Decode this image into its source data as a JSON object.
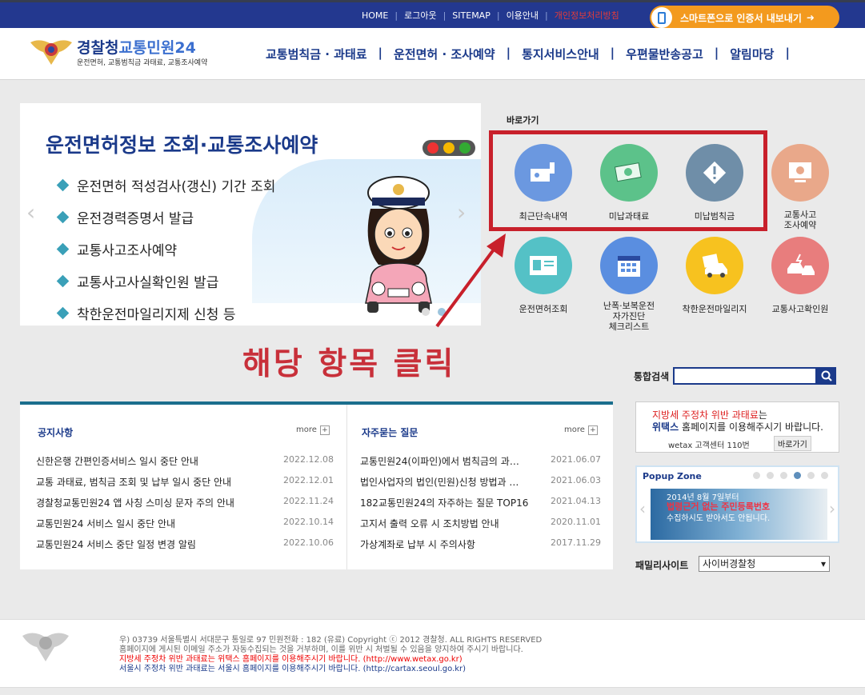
{
  "topbar": {
    "links": [
      "HOME",
      "로그아웃",
      "SITEMAP",
      "이용안내"
    ],
    "privacy": "개인정보처리방침",
    "smart_button": "스마트폰으로 인증서 내보내기"
  },
  "logo": {
    "brand1": "경찰청",
    "brand2": "교통민원24",
    "subtitle": "운전면허, 교통범칙금 과태료, 교통조사예약"
  },
  "gnb": [
    "교통범칙금 · 과태료",
    "운전면허 · 조사예약",
    "통지서비스안내",
    "우편물반송공고",
    "알림마당"
  ],
  "banner": {
    "title": "운전면허정보 조회·교통조사예약",
    "items": [
      "운전면허 적성검사(갱신) 기간 조회",
      "운전경력증명서 발급",
      "교통사고조사예약",
      "교통사고사실확인원 발급",
      "착한운전마일리지제 신청 등"
    ]
  },
  "quick": {
    "title": "바로가기",
    "items": [
      {
        "label": "최근단속내역",
        "color": "#6b98e0",
        "icon": "camera-icon"
      },
      {
        "label": "미납과태료",
        "color": "#5cc28a",
        "icon": "money-icon"
      },
      {
        "label": "미납범칙금",
        "color": "#6f8ea8",
        "icon": "warning-icon"
      },
      {
        "label": "교통사고\n조사예약",
        "color": "#e9a88a",
        "icon": "monitor-icon"
      },
      {
        "label": "운전면허조회",
        "color": "#54c1c6",
        "icon": "id-card-icon"
      },
      {
        "label": "난폭·보복운전\n자가진단\n체크리스트",
        "color": "#5a8ee0",
        "icon": "calendar-icon"
      },
      {
        "label": "착한운전마일리지",
        "color": "#f7c21f",
        "icon": "car-icon"
      },
      {
        "label": "교통사고확인원",
        "color": "#e87d7d",
        "icon": "accident-icon"
      }
    ]
  },
  "annotation": "해당 항목 클릭",
  "search": {
    "label": "통합검색",
    "value": ""
  },
  "notice": {
    "title": "공지사항",
    "more": "more",
    "rows": [
      {
        "text": "신한은행 간편인증서비스 일시 중단 안내",
        "date": "2022.12.08"
      },
      {
        "text": "교통 과태료, 범칙금 조회 및 납부 일시 중단 안내",
        "date": "2022.12.01"
      },
      {
        "text": "경찰청교통민원24 앱 사칭 스미싱 문자 주의 안내",
        "date": "2022.11.24"
      },
      {
        "text": "교통민원24 서비스 일시 중단 안내",
        "date": "2022.10.14"
      },
      {
        "text": "교통민원24 서비스 중단 일정 변경 알림",
        "date": "2022.10.06"
      }
    ]
  },
  "faq": {
    "title": "자주묻는 질문",
    "more": "more",
    "rows": [
      {
        "text": "교통민원24(이파인)에서 범칙금의 과…",
        "date": "2021.06.07"
      },
      {
        "text": "법인사업자의 법인(민원)신청 방법과 …",
        "date": "2021.06.03"
      },
      {
        "text": "182교통민원24의 자주하는 질문 TOP16",
        "date": "2021.04.13"
      },
      {
        "text": "고지서 출력 오류 시 조치방법 안내",
        "date": "2020.11.01"
      },
      {
        "text": "가상계좌로 납부 시 주의사항",
        "date": "2017.11.29"
      }
    ]
  },
  "wetax": {
    "line1a": "지방세 주정차 위반 과태료",
    "line1b": "는",
    "line2a": "위택스",
    "line2b": "홈페이지를 이용해주시기 바랍니다.",
    "line3": "wetax 고객센터 110번",
    "go": "바로가기"
  },
  "popup": {
    "title": "Popup Zone",
    "l1": "2014년 8월 7일부터",
    "l2": "법령근거 없는 주민등록번호",
    "l3": "수집하시도 받아서도 안됩니다."
  },
  "family": {
    "label": "패밀리사이트",
    "selected": "사이버경찰청"
  },
  "footer": {
    "l1": "우) 03739 서울특별시 서대문구 통일로 97  민원전화 : 182 (유료)       Copyright ⓒ 2012 경찰청. ALL RIGHTS RESERVED",
    "l2": "홈페이지에 게시된 이메일 주소가 자동수집되는 것을 거부하며, 이를 위반 시 처벌될 수 있음을 양지하여 주시기 바랍니다.",
    "l3": "지방세 주정차 위반 과태료는 위택스 홈페이지를 이용해주시기 바랍니다. (http://www.wetax.go.kr)",
    "l4": "서울시 주정차 위반 과태료는 서울시 홈페이지를 이용해주시기 바랍니다. (http://cartax.seoul.go.kr)"
  }
}
